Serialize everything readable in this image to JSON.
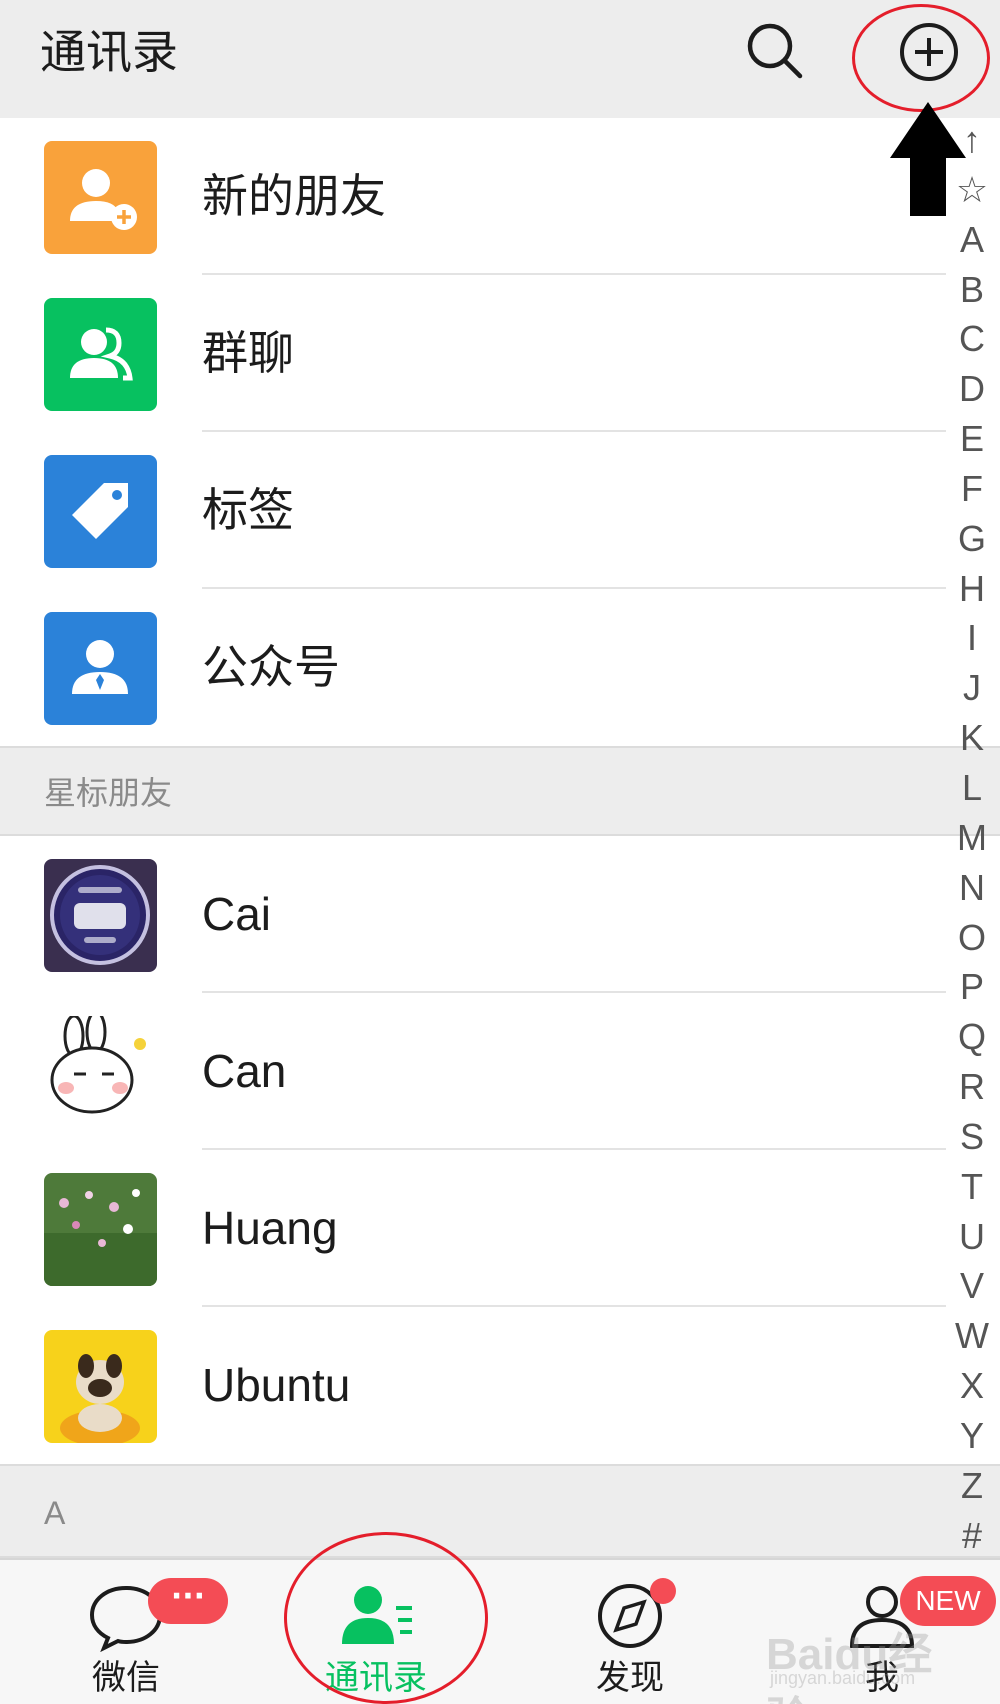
{
  "header": {
    "title": "通讯录",
    "search_icon": "search-icon",
    "add_icon": "plus-circle-icon"
  },
  "top_items": [
    {
      "label": "新的朋友",
      "icon": "add-friend-icon",
      "color": "#f9a23b"
    },
    {
      "label": "群聊",
      "icon": "group-chat-icon",
      "color": "#07c160"
    },
    {
      "label": "标签",
      "icon": "tag-icon",
      "color": "#2b82d9"
    },
    {
      "label": "公众号",
      "icon": "official-account-icon",
      "color": "#2b82d9"
    }
  ],
  "starred_section": {
    "title": "星标朋友"
  },
  "starred_contacts": [
    {
      "name": "Cai"
    },
    {
      "name": "Can"
    },
    {
      "name": "Huang"
    },
    {
      "name": "Ubuntu"
    }
  ],
  "section_a": {
    "title": "A"
  },
  "index_bar": [
    "↑",
    "☆",
    "A",
    "B",
    "C",
    "D",
    "E",
    "F",
    "G",
    "H",
    "I",
    "J",
    "K",
    "L",
    "M",
    "N",
    "O",
    "P",
    "Q",
    "R",
    "S",
    "T",
    "U",
    "V",
    "W",
    "X",
    "Y",
    "Z",
    "#"
  ],
  "bottom_nav": {
    "tabs": [
      {
        "label": "微信",
        "icon": "chat-bubble-icon"
      },
      {
        "label": "通讯录",
        "icon": "contacts-icon",
        "active": true
      },
      {
        "label": "发现",
        "icon": "compass-icon"
      },
      {
        "label": "我",
        "icon": "person-icon"
      }
    ],
    "chat_badge": "···",
    "me_badge": "NEW"
  },
  "watermark": {
    "brand": "Baidu经验",
    "url": "jingyan.baidu.com"
  },
  "colors": {
    "accent": "#07c160",
    "badge": "#f44c55",
    "annotation": "#e41e2b",
    "header_bg": "#ededed"
  }
}
